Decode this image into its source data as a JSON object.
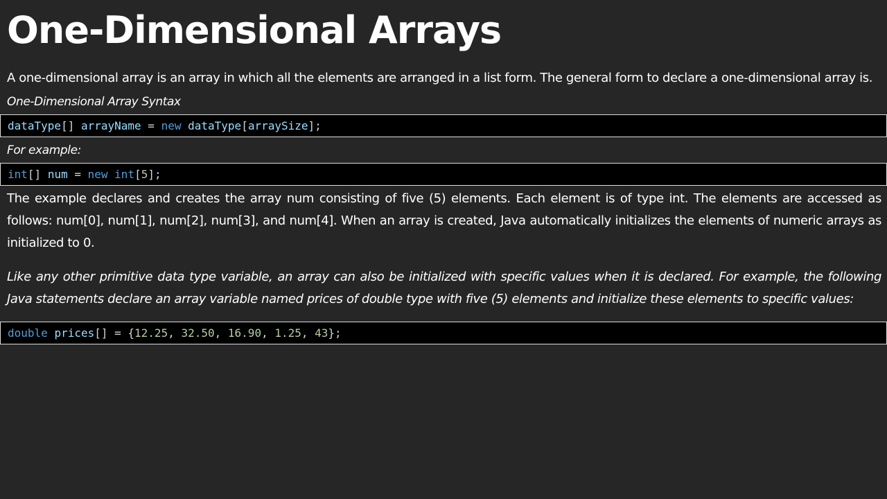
{
  "title": "One-Dimensional Arrays",
  "intro": "A one-dimensional array is an array in which all the elements are arranged in a list form. The general form to declare a one-dimensional array is.",
  "syntax_label": "One-Dimensional Array Syntax",
  "code1": [
    [
      "id",
      "dataType"
    ],
    [
      "pu",
      "[] "
    ],
    [
      "id",
      "arrayName"
    ],
    [
      "pu",
      " = "
    ],
    [
      "kw",
      "new"
    ],
    [
      "pu",
      " "
    ],
    [
      "id",
      "dataType"
    ],
    [
      "pu",
      "["
    ],
    [
      "id",
      "arraySize"
    ],
    [
      "pu",
      "];"
    ]
  ],
  "example_label": "For example:",
  "code2": [
    [
      "kw",
      "int"
    ],
    [
      "pu",
      "[] "
    ],
    [
      "id",
      "num"
    ],
    [
      "pu",
      " = "
    ],
    [
      "kw",
      "new"
    ],
    [
      "pu",
      " "
    ],
    [
      "kw",
      "int"
    ],
    [
      "pu",
      "["
    ],
    [
      "nu",
      "5"
    ],
    [
      "pu",
      "];"
    ]
  ],
  "para1": "The example declares and creates the array num consisting of five (5) elements. Each element is of type int. The elements are accessed as follows: num[0], num[1], num[2], num[3], and num[4]. When an array is created, Java automatically initializes the elements of numeric arrays as initialized to 0.",
  "para2": "Like any other primitive data type variable, an array can also be initialized with specific values when it is declared. For example, the following Java statements declare an array variable named prices of double type with five (5) elements and initialize these elements to specific values:",
  "code3": [
    [
      "kw",
      "double"
    ],
    [
      "pu",
      " "
    ],
    [
      "id",
      "prices"
    ],
    [
      "pu",
      "[] = {"
    ],
    [
      "nu",
      "12.25"
    ],
    [
      "pu",
      ", "
    ],
    [
      "nu",
      "32.50"
    ],
    [
      "pu",
      ", "
    ],
    [
      "nu",
      "16.90"
    ],
    [
      "pu",
      ", "
    ],
    [
      "nu",
      "1.25"
    ],
    [
      "pu",
      ", "
    ],
    [
      "nu",
      "43"
    ],
    [
      "pu",
      "};"
    ]
  ]
}
